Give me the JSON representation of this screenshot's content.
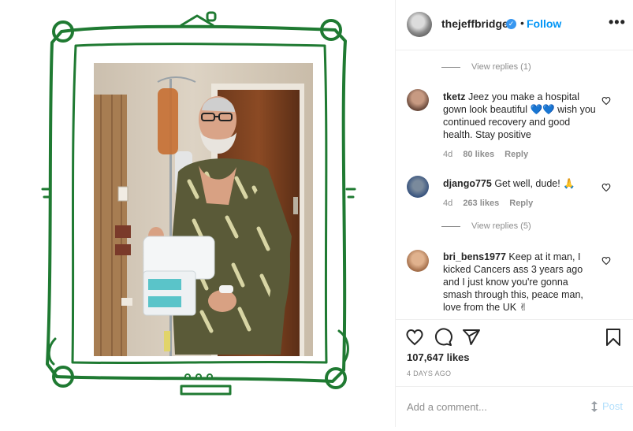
{
  "post": {
    "username": "thejeffbridges",
    "separator": "•",
    "follow_label": "Follow",
    "more_label": "•••",
    "verified_glyph": "✓"
  },
  "comments": [
    {
      "type": "view_replies",
      "label": "View replies (1)"
    },
    {
      "type": "comment",
      "username": "tketz",
      "text": "Jeez you make a hospital gown look beautiful 💙💙 wish you continued recovery and good health. Stay positive",
      "age": "4d",
      "likes": "80 likes",
      "reply": "Reply"
    },
    {
      "type": "comment",
      "username": "django775",
      "text": "Get well, dude! 🙏",
      "age": "4d",
      "likes": "263 likes",
      "reply": "Reply"
    },
    {
      "type": "view_replies",
      "label": "View replies (5)"
    },
    {
      "type": "comment",
      "username": "bri_bens1977",
      "text": "Keep at it man, I kicked Cancers ass 3 years ago and I just know you're gonna smash through this, peace man, love from the UK ✌"
    }
  ],
  "stats": {
    "likes": "107,647 likes",
    "date": "4 DAYS AGO"
  },
  "composer": {
    "placeholder": "Add a comment...",
    "post_label": "Post"
  },
  "colors": {
    "frame_green": "#1f7a32",
    "link_blue": "#0095f6",
    "verified_blue": "#3897f0",
    "muted": "#8e8e8e"
  },
  "icons": [
    "verified-icon",
    "heart-icon",
    "comment-icon",
    "share-icon",
    "bookmark-icon",
    "more-icon"
  ]
}
